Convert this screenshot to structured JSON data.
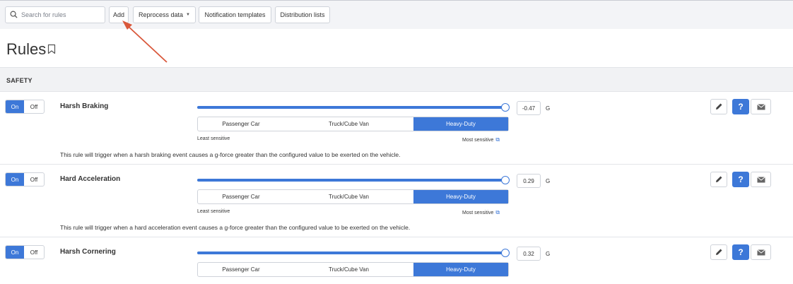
{
  "toolbar": {
    "search_placeholder": "Search for rules",
    "add_label": "Add",
    "reprocess_label": "Reprocess data",
    "notification_label": "Notification templates",
    "distribution_label": "Distribution lists"
  },
  "page": {
    "title": "Rules"
  },
  "section": {
    "title": "SAFETY"
  },
  "common": {
    "on": "On",
    "off": "Off",
    "unit": "G",
    "least": "Least sensitive",
    "most": "Most sensitive",
    "vehicle_types": [
      "Passenger Car",
      "Truck/Cube Van",
      "Heavy-Duty"
    ],
    "selected_vehicle": "Heavy-Duty",
    "accent_color": "#3d78d8"
  },
  "rules": [
    {
      "name": "Harsh Braking",
      "enabled": true,
      "value": "-0.47",
      "slider_position": 1.0,
      "description": "This rule will trigger when a harsh braking event causes a g-force greater than the configured value to be exerted on the vehicle."
    },
    {
      "name": "Hard Acceleration",
      "enabled": true,
      "value": "0.29",
      "slider_position": 1.0,
      "description": "This rule will trigger when a hard acceleration event causes a g-force greater than the configured value to be exerted on the vehicle."
    },
    {
      "name": "Harsh Cornering",
      "enabled": true,
      "value": "0.32",
      "slider_position": 1.0
    }
  ]
}
